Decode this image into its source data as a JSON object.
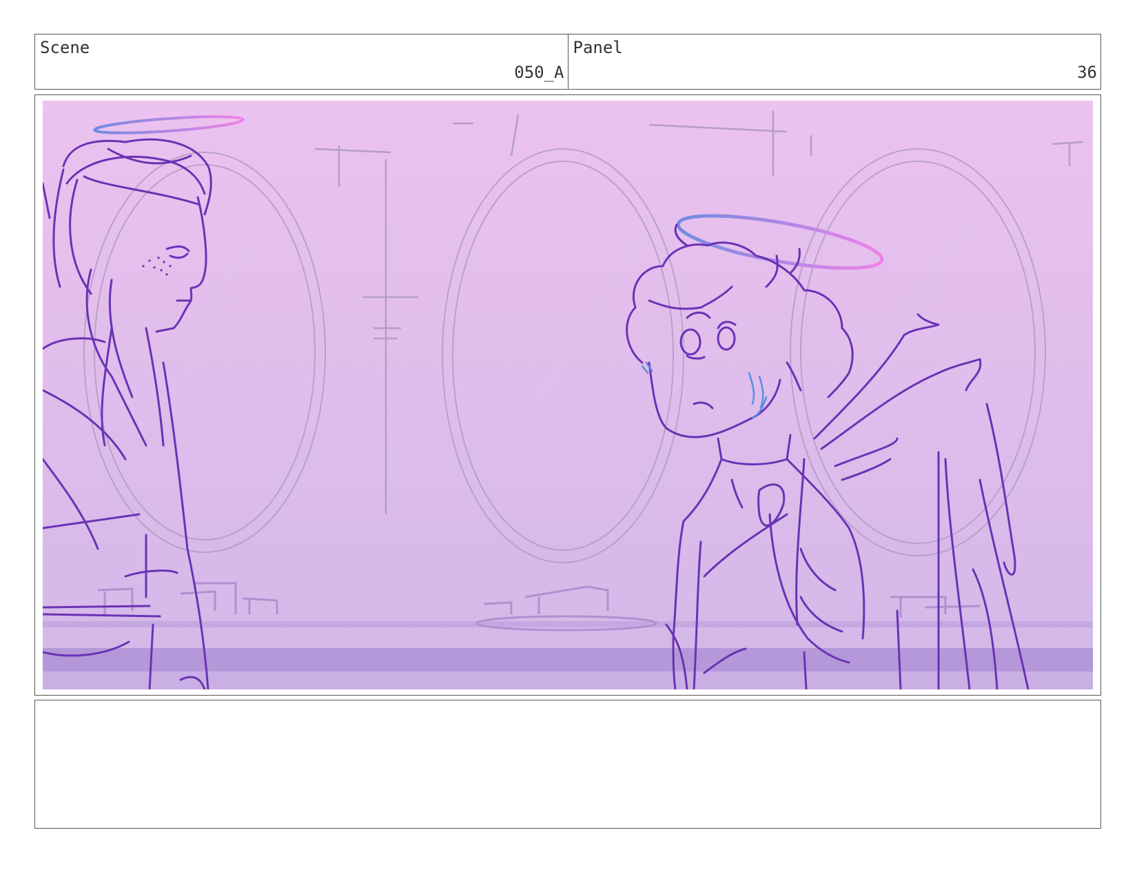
{
  "header": {
    "scene_label": "Scene",
    "scene_value": "050_A",
    "panel_label": "Panel",
    "panel_value": "36"
  },
  "artwork": {
    "colors": {
      "bg_top": "#ecc2ef",
      "bg_bottom": "#d2b8e8",
      "line": "#6a32b4",
      "faint_line": "#b49ec8",
      "halo_blue": "#6f8ce0",
      "halo_pink": "#ef83e8",
      "tear_blue": "#5b8ddf"
    }
  },
  "notes": {
    "text": ""
  }
}
